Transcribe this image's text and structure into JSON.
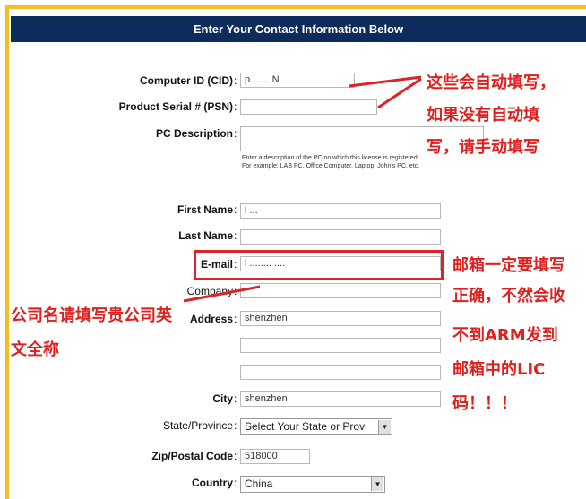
{
  "header": {
    "title": "Enter Your Contact Information Below"
  },
  "form": {
    "computer_id": {
      "label": "Computer ID (CID)",
      "value": "p ...... N"
    },
    "product_serial": {
      "label": "Product Serial # (PSN)",
      "value": ""
    },
    "pc_description": {
      "label": "PC Description",
      "value": "",
      "help_line1": "Enter a description of the PC on which this license is registered.",
      "help_line2": "For example: LAB PC, Office Computer, Laptop, John's PC, etc."
    },
    "first_name": {
      "label": "First Name",
      "value": "l ..."
    },
    "last_name": {
      "label": "Last Name",
      "value": ""
    },
    "email": {
      "label": "E-mail",
      "value": "l ........ ...."
    },
    "company": {
      "label": "Company",
      "value": ""
    },
    "address": {
      "label": "Address",
      "value1": "shenzhen",
      "value2": "",
      "value3": ""
    },
    "city": {
      "label": "City",
      "value": "shenzhen"
    },
    "state": {
      "label": "State/Province",
      "value": "Select Your State or Provi"
    },
    "zip": {
      "label": "Zip/Postal Code",
      "value": "518000"
    },
    "country": {
      "label": "Country",
      "value": "China"
    },
    "colon": ":"
  },
  "annotations": {
    "auto_fill": [
      "这些会自动填写，",
      "如果没有自动填",
      "写，请手动填写"
    ],
    "email_note": [
      "邮箱一定要填写",
      "正确，不然会收",
      "不到ARM发到",
      "邮箱中的LIC",
      "码！！！"
    ],
    "company_note": [
      "公司名请填写贵公司英",
      "文全称"
    ]
  },
  "colors": {
    "header_bg": "#0d2c5c",
    "frame_accent": "#f2c01d",
    "annotation_red": "#e0201f"
  }
}
